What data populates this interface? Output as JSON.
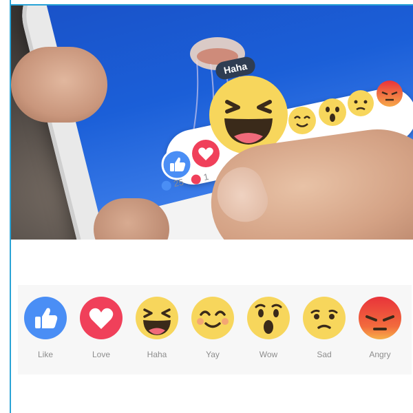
{
  "photo": {
    "tooltip_label": "Haha",
    "counts": {
      "like_count": "25",
      "love_count": "1"
    }
  },
  "reactions": [
    {
      "label": "Like",
      "icon": "like-icon",
      "color": "#4a8ef5"
    },
    {
      "label": "Love",
      "icon": "love-icon",
      "color": "#f0405a"
    },
    {
      "label": "Haha",
      "icon": "haha-icon",
      "color": "#f7d65c"
    },
    {
      "label": "Yay",
      "icon": "yay-icon",
      "color": "#f7d65c"
    },
    {
      "label": "Wow",
      "icon": "wow-icon",
      "color": "#f7d65c"
    },
    {
      "label": "Sad",
      "icon": "sad-icon",
      "color": "#f7d65c"
    },
    {
      "label": "Angry",
      "icon": "angry-icon",
      "color": "#e8333a"
    }
  ]
}
